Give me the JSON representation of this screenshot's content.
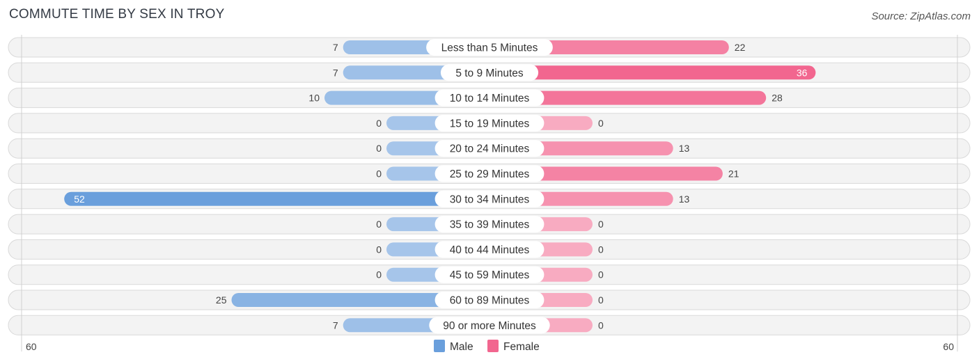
{
  "header": {
    "title": "COMMUTE TIME BY SEX IN TROY",
    "source": "Source: ZipAtlas.com"
  },
  "chart_data": {
    "type": "bar",
    "orientation": "horizontal-diverging",
    "title": "COMMUTE TIME BY SEX IN TROY",
    "categories": [
      "Less than 5 Minutes",
      "5 to 9 Minutes",
      "10 to 14 Minutes",
      "15 to 19 Minutes",
      "20 to 24 Minutes",
      "25 to 29 Minutes",
      "30 to 34 Minutes",
      "35 to 39 Minutes",
      "40 to 44 Minutes",
      "45 to 59 Minutes",
      "60 to 89 Minutes",
      "90 or more Minutes"
    ],
    "series": [
      {
        "name": "Male",
        "color": "#6a9fdc",
        "values": [
          7,
          7,
          10,
          0,
          0,
          0,
          52,
          0,
          0,
          0,
          25,
          7
        ]
      },
      {
        "name": "Female",
        "color": "#f2668f",
        "values": [
          22,
          36,
          28,
          0,
          13,
          21,
          13,
          0,
          0,
          0,
          0,
          0
        ]
      }
    ],
    "axis": {
      "left_label": "60",
      "right_label": "60",
      "range": [
        60,
        60
      ]
    },
    "legend": {
      "position": "bottom-center",
      "entries": [
        "Male",
        "Female"
      ]
    },
    "xlabel": "",
    "ylabel": ""
  }
}
